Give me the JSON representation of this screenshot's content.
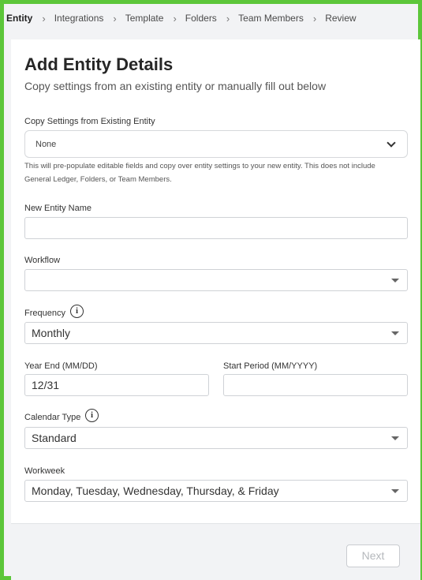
{
  "breadcrumb": {
    "steps": [
      "Entity",
      "Integrations",
      "Template",
      "Folders",
      "Team Members",
      "Review"
    ],
    "active": "Entity"
  },
  "header": {
    "title": "Add Entity Details",
    "subtitle": "Copy settings from an existing entity or manually fill out below"
  },
  "copy_settings": {
    "label": "Copy Settings from Existing Entity",
    "value": "None",
    "help": "This will pre-populate editable fields and copy over entity settings to your new entity. This does not include General Ledger, Folders, or Team Members."
  },
  "entity_name": {
    "label": "New Entity Name",
    "value": ""
  },
  "workflow": {
    "label": "Workflow",
    "value": ""
  },
  "frequency": {
    "label": "Frequency",
    "value": "Monthly"
  },
  "year_end": {
    "label": "Year End (MM/DD)",
    "value": "12/31"
  },
  "start_period": {
    "label": "Start Period (MM/YYYY)",
    "value": ""
  },
  "calendar_type": {
    "label": "Calendar Type",
    "value": "Standard"
  },
  "workweek": {
    "label": "Workweek",
    "value": "Monday, Tuesday, Wednesday, Thursday, & Friday"
  },
  "footer": {
    "next_label": "Next"
  },
  "icons": {
    "info": "i",
    "separator": "›"
  },
  "colors": {
    "frame_border": "#5cc63a",
    "background": "#f2f3f5"
  }
}
